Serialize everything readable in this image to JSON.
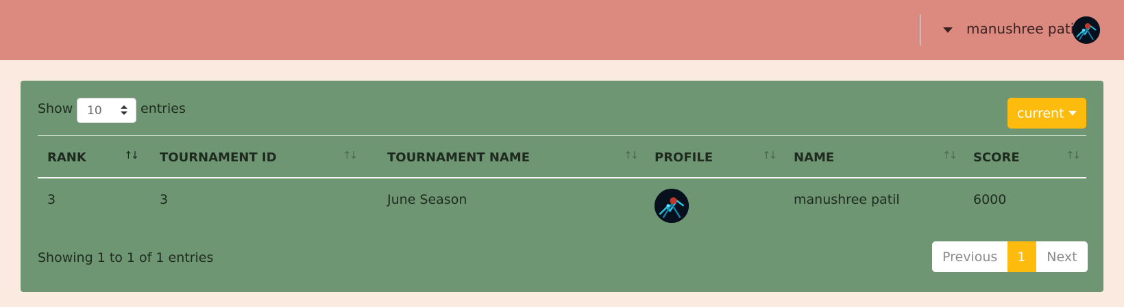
{
  "header": {
    "user_name": "manushree patil",
    "dropdown_icon": "caret-down-icon",
    "avatar_icon": "user-avatar"
  },
  "table_controls": {
    "show_label": "Show",
    "entries_label": "entries",
    "page_length_value": "10",
    "filter_button_label": "current"
  },
  "table": {
    "columns": [
      "RANK",
      "TOURNAMENT ID",
      "TOURNAMENT NAME",
      "PROFILE",
      "NAME",
      "SCORE"
    ],
    "rows": [
      {
        "rank": "3",
        "tournament_id": "3",
        "tournament_name": "June Season",
        "profile": "avatar",
        "name": "manushree patil",
        "score": "6000"
      }
    ],
    "sorted_column": "RANK"
  },
  "pagination": {
    "info": "Showing 1 to 1 of 1 entries",
    "previous_label": "Previous",
    "current_page": "1",
    "next_label": "Next"
  },
  "colors": {
    "header_bg": "#dc8a7f",
    "page_bg": "#faeadf",
    "card_bg": "#6e9673",
    "accent": "#fdbb0e"
  }
}
